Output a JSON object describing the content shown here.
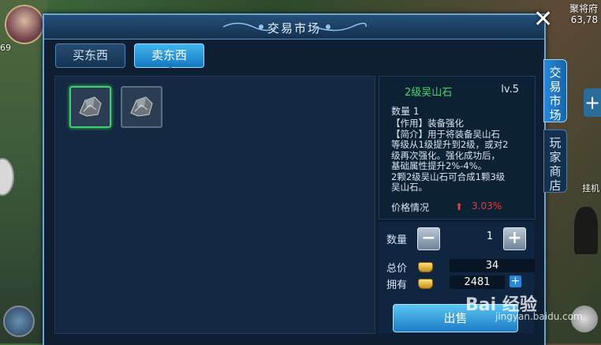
{
  "background": {
    "level_badge": "69",
    "top_right_line1": "聚将府",
    "top_right_line2": "63,78",
    "right_side_label": "挂机"
  },
  "window": {
    "title": "交易市场",
    "close_label": "✕"
  },
  "tabs": [
    {
      "label": "买东西",
      "active": false
    },
    {
      "label": "卖东西",
      "active": true
    }
  ],
  "side_tabs": [
    {
      "label": "交易市场",
      "active": true
    },
    {
      "label": "玩家商店",
      "active": false
    }
  ],
  "inventory": {
    "slots": [
      {
        "icon": "stone-icon",
        "selected": true
      },
      {
        "icon": "stone-icon",
        "selected": false
      }
    ]
  },
  "detail": {
    "name": "2级吴山石",
    "level": "lv.5",
    "quantity_line": "数量  1",
    "description_lines": [
      "【作用】装备强化",
      "【简介】用于将装备吴山石",
      "等级从1级提升到2级，或对2",
      "级再次强化。强化成功后，",
      "基础属性提升2%-4%。",
      "2颗2级吴山石可合成1颗3级",
      "吴山石。"
    ],
    "price_label": "价格情况",
    "price_change": "3.03%",
    "price_trend": "up",
    "name_color": "#46d86a",
    "change_color": "#e83a3a"
  },
  "controls": {
    "quantity_label": "数量",
    "quantity_value": "1",
    "minus_label": "−",
    "plus_label": "+",
    "total_label": "总价",
    "total_value": "34",
    "owned_label": "拥有",
    "owned_value": "2481",
    "add_money_label": "+",
    "sell_label": "出售"
  },
  "watermark": {
    "text": "Bai 经验",
    "url": "jingyan.baidu.com"
  }
}
